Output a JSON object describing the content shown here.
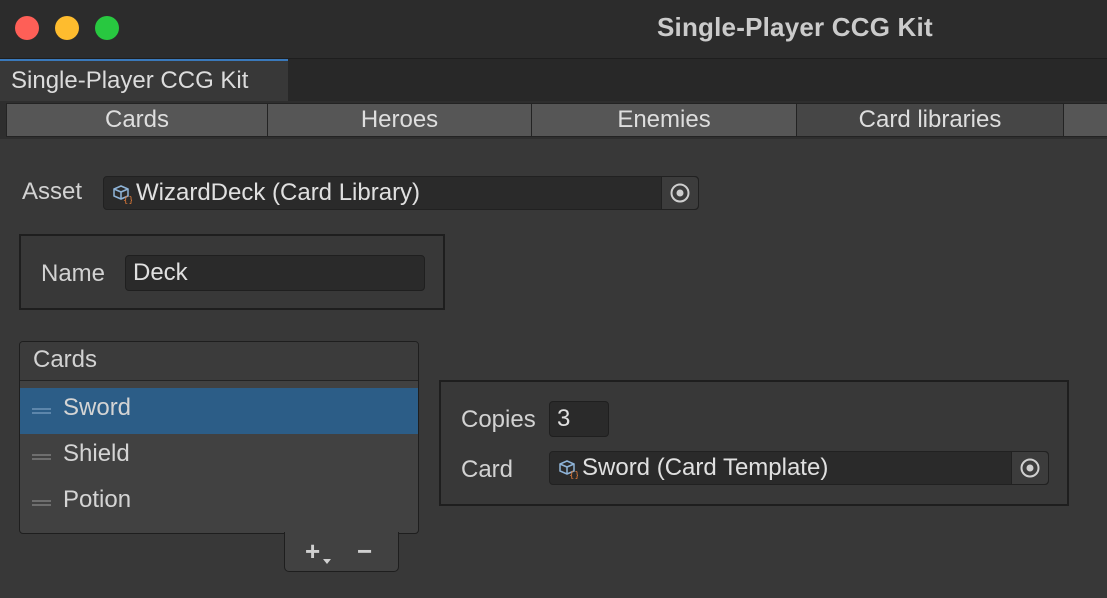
{
  "window": {
    "title": "Single-Player CCG Kit"
  },
  "window_tab": {
    "label": "Single-Player CCG Kit"
  },
  "tabs": [
    {
      "label": "Cards",
      "selected": false
    },
    {
      "label": "Heroes",
      "selected": false
    },
    {
      "label": "Enemies",
      "selected": false
    },
    {
      "label": "Card libraries",
      "selected": true
    }
  ],
  "asset": {
    "label": "Asset",
    "value": "WizardDeck (Card Library)"
  },
  "name_field": {
    "label": "Name",
    "value": "Deck"
  },
  "cards_list": {
    "header": "Cards",
    "items": [
      {
        "label": "Sword",
        "selected": true
      },
      {
        "label": "Shield",
        "selected": false
      },
      {
        "label": "Potion",
        "selected": false
      }
    ],
    "add_glyph": "+",
    "remove_glyph": "−"
  },
  "detail": {
    "copies_label": "Copies",
    "copies_value": "3",
    "card_label": "Card",
    "card_value": "Sword (Card Template)"
  },
  "colors": {
    "accent": "#3a79bb",
    "selection": "#2c5d87",
    "background": "#383838"
  }
}
